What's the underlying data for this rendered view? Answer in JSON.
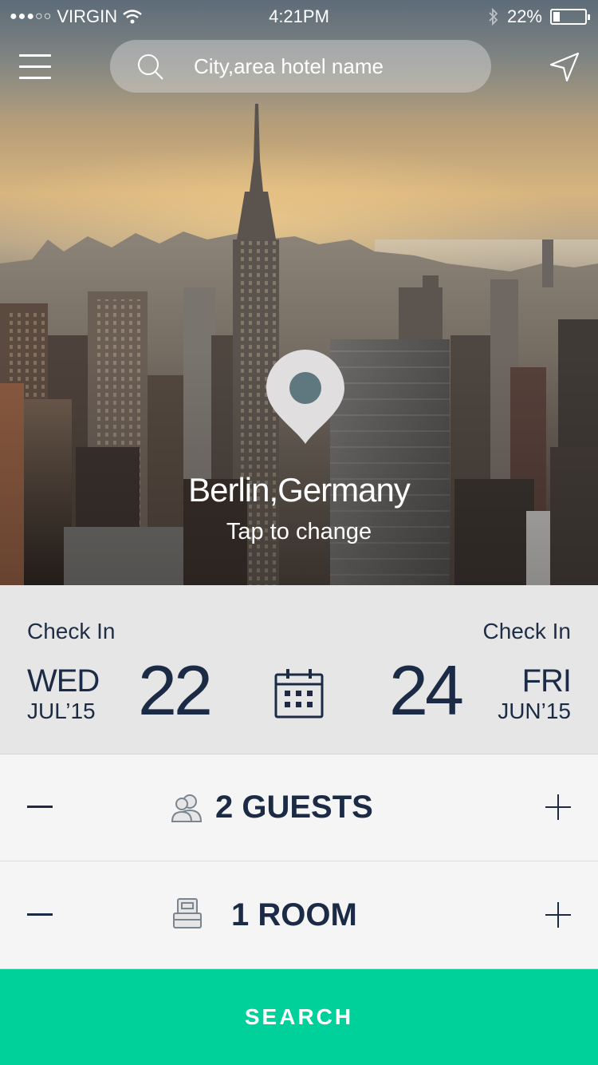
{
  "status_bar": {
    "signal": "●●●○○",
    "carrier": "VIRGIN",
    "time": "4:21PM",
    "battery": "22%",
    "battery_level": 0.22
  },
  "search": {
    "placeholder": "City,area hotel name"
  },
  "location": {
    "city": "Berlin,Germany",
    "hint": "Tap to change"
  },
  "dates": {
    "check_in": {
      "label": "Check In",
      "dow": "WED",
      "month": "JUL’15",
      "day": "22"
    },
    "check_out": {
      "label": "Check In",
      "dow": "FRI",
      "month": "JUN’15",
      "day": "24"
    }
  },
  "guests": {
    "label": "2 GUESTS"
  },
  "rooms": {
    "label": "1 ROOM"
  },
  "search_button": {
    "label": "SEARCH"
  },
  "colors": {
    "accent": "#00d19a",
    "text_dark": "#1c2b45",
    "date_panel": "#e6e6e6",
    "pin_fill": "#e0dede",
    "pin_dot": "#5f7880"
  },
  "icons": [
    "menu-icon",
    "search-icon",
    "navigation-arrow-icon",
    "location-pin-icon",
    "calendar-icon",
    "guests-icon",
    "bed-icon",
    "minus-icon",
    "plus-icon",
    "wifi-icon",
    "bluetooth-icon",
    "battery-icon"
  ]
}
